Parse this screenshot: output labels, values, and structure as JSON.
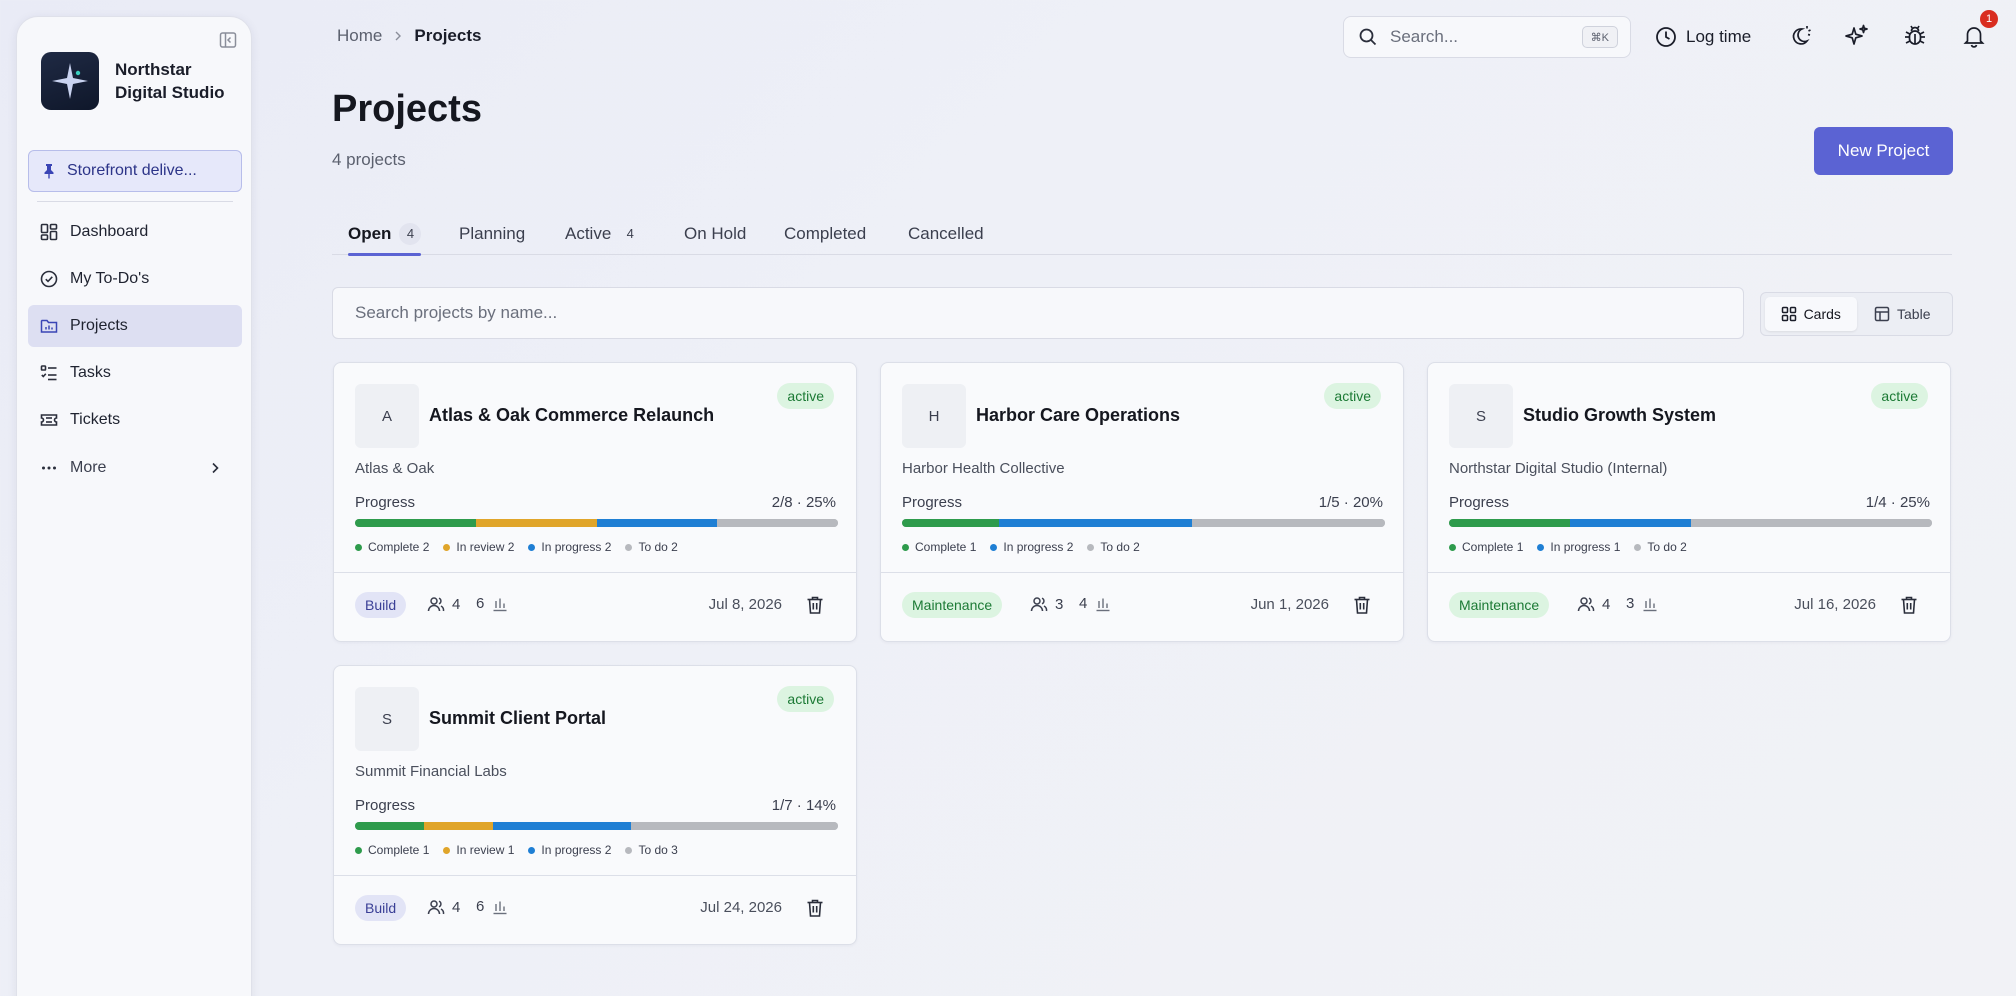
{
  "sidebar": {
    "brand": "Northstar Digital Studio",
    "pinned": "Storefront delive...",
    "items": [
      {
        "label": "Dashboard"
      },
      {
        "label": "My To-Do's"
      },
      {
        "label": "Projects"
      },
      {
        "label": "Tasks"
      },
      {
        "label": "Tickets"
      }
    ],
    "more": "More"
  },
  "breadcrumb": {
    "home": "Home",
    "current": "Projects"
  },
  "topbar": {
    "search_placeholder": "Search...",
    "search_kbd": "⌘K",
    "log_time": "Log time",
    "notification_count": "1"
  },
  "page": {
    "title": "Projects",
    "subtitle": "4 projects",
    "new_button": "New Project"
  },
  "tabs": [
    {
      "label": "Open",
      "count": "4"
    },
    {
      "label": "Planning",
      "count": ""
    },
    {
      "label": "Active",
      "count": "4"
    },
    {
      "label": "On Hold",
      "count": ""
    },
    {
      "label": "Completed",
      "count": ""
    },
    {
      "label": "Cancelled",
      "count": ""
    }
  ],
  "project_search_placeholder": "Search projects by name...",
  "view_toggle": {
    "cards": "Cards",
    "table": "Table"
  },
  "colors": {
    "complete": "#2e9b4c",
    "in_review": "#e0a52a",
    "in_progress": "#1f7fd4",
    "to_do": "#b7b9be",
    "accent": "#5b63d3"
  },
  "projects": [
    {
      "initial": "A",
      "name": "Atlas & Oak Commerce Relaunch",
      "status": "active",
      "client": "Atlas & Oak",
      "progress_label": "Progress",
      "progress": "2/8 · 25%",
      "segments": {
        "complete": 2,
        "in_review": 2,
        "in_progress": 2,
        "to_do": 2
      },
      "legend": [
        "Complete 2",
        "In review 2",
        "In progress 2",
        "To do 2"
      ],
      "tag": "Build",
      "members": "4",
      "tasks": "6",
      "date": "Jul 8, 2026"
    },
    {
      "initial": "H",
      "name": "Harbor Care Operations",
      "status": "active",
      "client": "Harbor Health Collective",
      "progress_label": "Progress",
      "progress": "1/5 · 20%",
      "segments": {
        "complete": 1,
        "in_review": 0,
        "in_progress": 2,
        "to_do": 2
      },
      "legend": [
        "Complete 1",
        "In progress 2",
        "To do 2"
      ],
      "tag": "Maintenance",
      "members": "3",
      "tasks": "4",
      "date": "Jun 1, 2026"
    },
    {
      "initial": "S",
      "name": "Studio Growth System",
      "status": "active",
      "client": "Northstar Digital Studio (Internal)",
      "progress_label": "Progress",
      "progress": "1/4 · 25%",
      "segments": {
        "complete": 1,
        "in_review": 0,
        "in_progress": 1,
        "to_do": 2
      },
      "legend": [
        "Complete 1",
        "In progress 1",
        "To do 2"
      ],
      "tag": "Maintenance",
      "members": "4",
      "tasks": "3",
      "date": "Jul 16, 2026"
    },
    {
      "initial": "S",
      "name": "Summit Client Portal",
      "status": "active",
      "client": "Summit Financial Labs",
      "progress_label": "Progress",
      "progress": "1/7 · 14%",
      "segments": {
        "complete": 1,
        "in_review": 1,
        "in_progress": 2,
        "to_do": 3
      },
      "legend": [
        "Complete 1",
        "In review 1",
        "In progress 2",
        "To do 3"
      ],
      "tag": "Build",
      "members": "4",
      "tasks": "6",
      "date": "Jul 24, 2026"
    }
  ]
}
